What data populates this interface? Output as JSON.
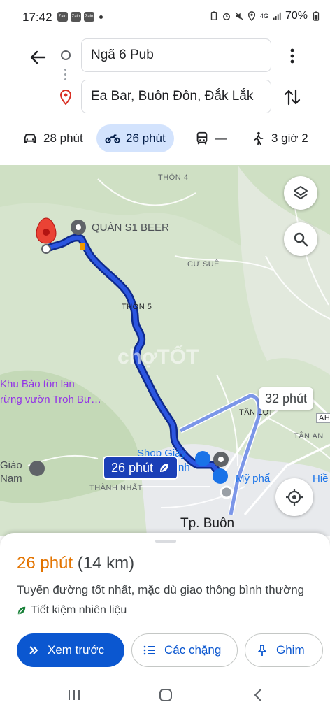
{
  "status": {
    "time": "17:42",
    "apps": [
      "Zalo",
      "Zalo",
      "Zalo"
    ],
    "signal": "4G",
    "battery": "70%"
  },
  "header": {
    "origin": "Ngã 6 Pub",
    "destination": "Ea Bar, Buôn Đôn, Đắk Lắk",
    "modes": [
      {
        "icon": "car-icon",
        "label": "28 phút"
      },
      {
        "icon": "motorbike-icon",
        "label": "26 phút"
      },
      {
        "icon": "transit-icon",
        "label": "—"
      },
      {
        "icon": "walk-icon",
        "label": "3 giờ 2"
      }
    ]
  },
  "map": {
    "labels": {
      "thon4": "THÔN 4",
      "thon5": "THÔN 5",
      "cusue": "CƯ SUÊ",
      "tanloi": "TÂN LỢI",
      "tanan": "TÂN AN",
      "thanhnhat": "THÀNH NHẤT",
      "ah": "AH"
    },
    "pois": {
      "quan": "QUÁN S1 BEER",
      "khu1": "Khu Bảo tồn lan",
      "khu2": "rừng vườn Troh Bư…",
      "giao1": "Giáo",
      "giao2": "Nam",
      "shop1": "Shop Giày",
      "shop2": "nh",
      "mypham": "Mỹ phẩ",
      "hie": "Hiề"
    },
    "city": "Tp. Buôn",
    "route_chip": "26 phút",
    "alt_chip": "32 phút",
    "watermark": "chợTỐT"
  },
  "sheet": {
    "eta_minutes": "26 phút",
    "eta_distance": "(14 km)",
    "description": "Tuyến đường tốt nhất, mặc dù giao thông bình thường",
    "eco": "Tiết kiệm nhiên liệu",
    "buttons": {
      "preview": "Xem trước",
      "steps": "Các chặng",
      "pin": "Ghim"
    }
  },
  "colors": {
    "route": "#1a3fb7",
    "alt_route": "#7b96e8",
    "eta": "#e37400",
    "primary": "#0b57d0"
  }
}
